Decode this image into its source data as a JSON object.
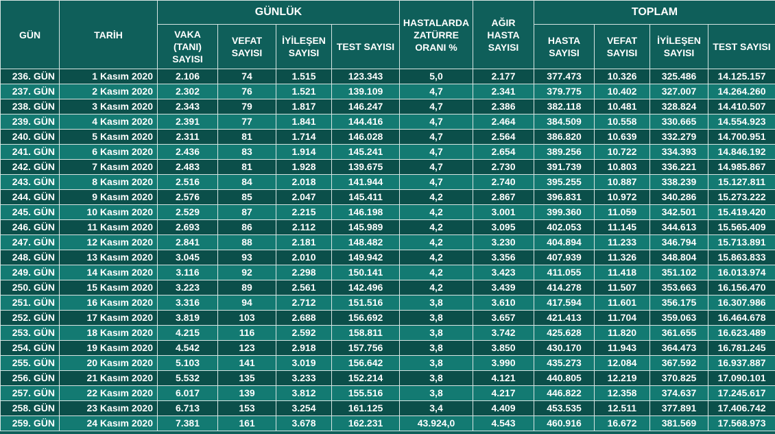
{
  "headers": {
    "gun": "GÜN",
    "tarih": "TARİH",
    "gunluk": "GÜNLÜK",
    "zatürre": [
      "HASTALARDA",
      "ZATÜRRE",
      "ORANI %"
    ],
    "agir": [
      "AĞIR",
      "HASTA",
      "SAYISI"
    ],
    "toplam": "TOPLAM",
    "daily_cols": [
      [
        "VAKA",
        "(TANI)",
        "SAYISI"
      ],
      [
        "VEFAT",
        "SAYISI"
      ],
      [
        "İYİLEŞEN",
        "SAYISI"
      ],
      [
        "TEST SAYISI"
      ]
    ],
    "total_cols": [
      [
        "HASTA",
        "SAYISI"
      ],
      [
        "VEFAT",
        "SAYISI"
      ],
      [
        "İYİLEŞEN",
        "SAYISI"
      ],
      [
        "TEST SAYISI"
      ]
    ]
  },
  "rows": [
    [
      "236. GÜN",
      "1 Kasım 2020",
      "2.106",
      "74",
      "1.515",
      "123.343",
      "5,0",
      "2.177",
      "377.473",
      "10.326",
      "325.486",
      "14.125.157"
    ],
    [
      "237. GÜN",
      "2 Kasım 2020",
      "2.302",
      "76",
      "1.521",
      "139.109",
      "4,7",
      "2.341",
      "379.775",
      "10.402",
      "327.007",
      "14.264.260"
    ],
    [
      "238. GÜN",
      "3 Kasım 2020",
      "2.343",
      "79",
      "1.817",
      "146.247",
      "4,7",
      "2.386",
      "382.118",
      "10.481",
      "328.824",
      "14.410.507"
    ],
    [
      "239. GÜN",
      "4 Kasım 2020",
      "2.391",
      "77",
      "1.841",
      "144.416",
      "4,7",
      "2.464",
      "384.509",
      "10.558",
      "330.665",
      "14.554.923"
    ],
    [
      "240. GÜN",
      "5 Kasım 2020",
      "2.311",
      "81",
      "1.714",
      "146.028",
      "4,7",
      "2.564",
      "386.820",
      "10.639",
      "332.279",
      "14.700.951"
    ],
    [
      "241. GÜN",
      "6 Kasım 2020",
      "2.436",
      "83",
      "1.914",
      "145.241",
      "4,7",
      "2.654",
      "389.256",
      "10.722",
      "334.393",
      "14.846.192"
    ],
    [
      "242. GÜN",
      "7 Kasım 2020",
      "2.483",
      "81",
      "1.928",
      "139.675",
      "4,7",
      "2.730",
      "391.739",
      "10.803",
      "336.221",
      "14.985.867"
    ],
    [
      "243. GÜN",
      "8 Kasım 2020",
      "2.516",
      "84",
      "2.018",
      "141.944",
      "4,7",
      "2.740",
      "395.255",
      "10.887",
      "338.239",
      "15.127.811"
    ],
    [
      "244. GÜN",
      "9 Kasım 2020",
      "2.576",
      "85",
      "2.047",
      "145.411",
      "4,2",
      "2.867",
      "396.831",
      "10.972",
      "340.286",
      "15.273.222"
    ],
    [
      "245. GÜN",
      "10 Kasım 2020",
      "2.529",
      "87",
      "2.215",
      "146.198",
      "4,2",
      "3.001",
      "399.360",
      "11.059",
      "342.501",
      "15.419.420"
    ],
    [
      "246. GÜN",
      "11 Kasım 2020",
      "2.693",
      "86",
      "2.112",
      "145.989",
      "4,2",
      "3.095",
      "402.053",
      "11.145",
      "344.613",
      "15.565.409"
    ],
    [
      "247. GÜN",
      "12 Kasım 2020",
      "2.841",
      "88",
      "2.181",
      "148.482",
      "4,2",
      "3.230",
      "404.894",
      "11.233",
      "346.794",
      "15.713.891"
    ],
    [
      "248. GÜN",
      "13 Kasım 2020",
      "3.045",
      "93",
      "2.010",
      "149.942",
      "4,2",
      "3.356",
      "407.939",
      "11.326",
      "348.804",
      "15.863.833"
    ],
    [
      "249. GÜN",
      "14 Kasım 2020",
      "3.116",
      "92",
      "2.298",
      "150.141",
      "4,2",
      "3.423",
      "411.055",
      "11.418",
      "351.102",
      "16.013.974"
    ],
    [
      "250. GÜN",
      "15 Kasım 2020",
      "3.223",
      "89",
      "2.561",
      "142.496",
      "4,2",
      "3.439",
      "414.278",
      "11.507",
      "353.663",
      "16.156.470"
    ],
    [
      "251. GÜN",
      "16 Kasım 2020",
      "3.316",
      "94",
      "2.712",
      "151.516",
      "3,8",
      "3.610",
      "417.594",
      "11.601",
      "356.175",
      "16.307.986"
    ],
    [
      "252. GÜN",
      "17 Kasım 2020",
      "3.819",
      "103",
      "2.688",
      "156.692",
      "3,8",
      "3.657",
      "421.413",
      "11.704",
      "359.063",
      "16.464.678"
    ],
    [
      "253. GÜN",
      "18 Kasım 2020",
      "4.215",
      "116",
      "2.592",
      "158.811",
      "3,8",
      "3.742",
      "425.628",
      "11.820",
      "361.655",
      "16.623.489"
    ],
    [
      "254. GÜN",
      "19 Kasım 2020",
      "4.542",
      "123",
      "2.918",
      "157.756",
      "3,8",
      "3.850",
      "430.170",
      "11.943",
      "364.473",
      "16.781.245"
    ],
    [
      "255. GÜN",
      "20 Kasım 2020",
      "5.103",
      "141",
      "3.019",
      "156.642",
      "3,8",
      "3.990",
      "435.273",
      "12.084",
      "367.592",
      "16.937.887"
    ],
    [
      "256. GÜN",
      "21 Kasım 2020",
      "5.532",
      "135",
      "3.233",
      "152.214",
      "3,8",
      "4.121",
      "440.805",
      "12.219",
      "370.825",
      "17.090.101"
    ],
    [
      "257. GÜN",
      "22 Kasım 2020",
      "6.017",
      "139",
      "3.812",
      "155.516",
      "3,8",
      "4.217",
      "446.822",
      "12.358",
      "374.637",
      "17.245.617"
    ],
    [
      "258. GÜN",
      "23 Kasım 2020",
      "6.713",
      "153",
      "3.254",
      "161.125",
      "3,4",
      "4.409",
      "453.535",
      "12.511",
      "377.891",
      "17.406.742"
    ],
    [
      "259. GÜN",
      "24 Kasım 2020",
      "7.381",
      "161",
      "3.678",
      "162.231",
      "43.924,0",
      "4.543",
      "460.916",
      "16.672",
      "381.569",
      "17.568.973"
    ]
  ]
}
